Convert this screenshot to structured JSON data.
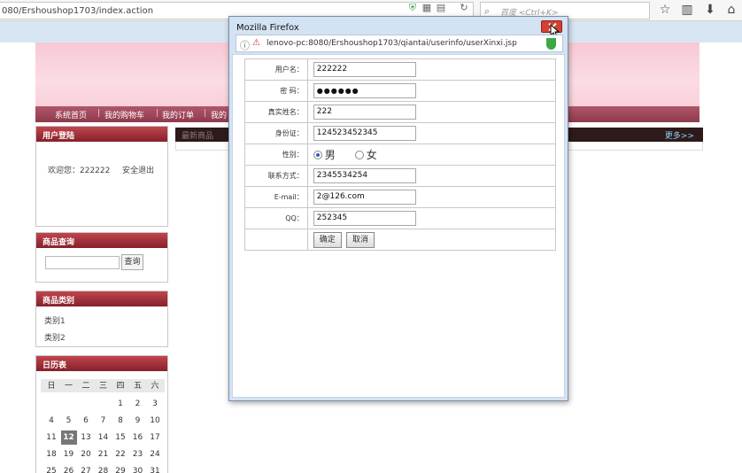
{
  "browser": {
    "url": "080/Ershoushop1703/index.action",
    "search_placeholder": "百度 <Ctrl+K>"
  },
  "nav": {
    "items": [
      "系统首页",
      "我的购物车",
      "我的订单",
      "我的"
    ]
  },
  "panels": {
    "login": {
      "title": "用户登陆",
      "welcome": "欢迎您：222222",
      "logout": "安全退出"
    },
    "search": {
      "title": "商品查询",
      "button": "查询"
    },
    "category": {
      "title": "商品类别",
      "items": [
        "类别1",
        "类别2"
      ]
    },
    "calendar": {
      "title": "日历表",
      "weekdays": [
        "日",
        "一",
        "二",
        "三",
        "四",
        "五",
        "六"
      ],
      "today": "12"
    }
  },
  "main": {
    "bar_left": "最新商品",
    "bar_right": "更多>>"
  },
  "popup": {
    "title": "Mozilla Firefox",
    "url": "lenovo-pc:8080/Ershoushop1703/qiantai/userinfo/userXinxi.jsp",
    "form": {
      "username_label": "用户名：",
      "username": "222222",
      "password_label": "密 码：",
      "password": "●●●●●●",
      "realname_label": "真实姓名：",
      "realname": "222",
      "idcard_label": "身份证：",
      "idcard": "124523452345",
      "gender_label": "性别：",
      "gender_male": "男",
      "gender_female": "女",
      "contact_label": "联系方式：",
      "contact": "2345534254",
      "email_label": "E-mail：",
      "email": "2@126.com",
      "qq_label": "QQ：",
      "qq": "252345",
      "confirm": "确定",
      "cancel": "取消"
    }
  }
}
